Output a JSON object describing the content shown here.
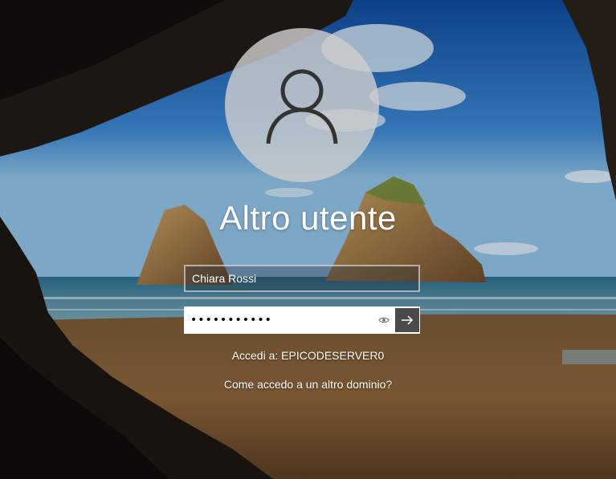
{
  "login": {
    "user_name": "Altro utente",
    "username_value": "Chiara Rossi",
    "password_mask": "•••••••••••",
    "signin_prefix": "Accedi a: EPICODESERVER0",
    "other_domain_link": "Come accedo a un altro dominio?"
  },
  "icons": {
    "avatar": "user-silhouette-icon",
    "reveal": "eye-icon",
    "submit": "arrow-right-icon"
  },
  "colors": {
    "submit_button": "#4a4a4a",
    "text": "#ffffff"
  }
}
